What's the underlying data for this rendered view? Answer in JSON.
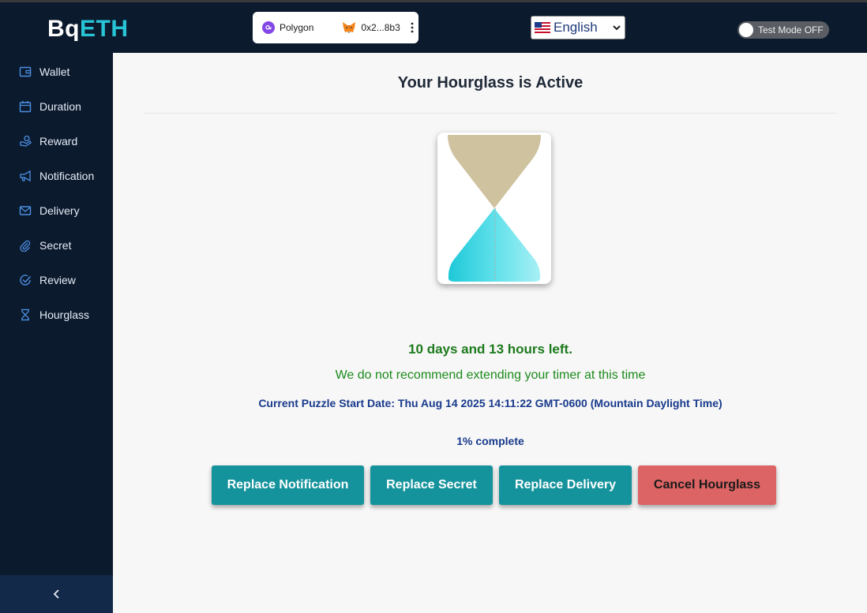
{
  "header": {
    "logo_main": "Bq",
    "logo_accent": "ETH",
    "network": "Polygon",
    "wallet_address": "0x2...8b3",
    "language": "English",
    "test_mode_label": "Test Mode OFF",
    "test_mode_on": false
  },
  "sidebar": {
    "items": [
      {
        "label": "Wallet",
        "icon": "wallet-icon"
      },
      {
        "label": "Duration",
        "icon": "calendar-icon"
      },
      {
        "label": "Reward",
        "icon": "reward-icon"
      },
      {
        "label": "Notification",
        "icon": "megaphone-icon"
      },
      {
        "label": "Delivery",
        "icon": "envelope-icon"
      },
      {
        "label": "Secret",
        "icon": "paperclip-icon"
      },
      {
        "label": "Review",
        "icon": "check-circle-icon"
      },
      {
        "label": "Hourglass",
        "icon": "hourglass-icon"
      }
    ],
    "collapse_icon": "chevron-left-icon"
  },
  "main": {
    "title": "Your Hourglass is Active",
    "time_left": "10 days and 13 hours left.",
    "recommendation": "We do not recommend extending your timer at this time",
    "start_date": "Current Puzzle Start Date: Thu Aug 14 2025 14:11:22 GMT-0600 (Mountain Daylight Time)",
    "progress_text": "1% complete",
    "progress_fraction": 0.01
  },
  "actions": {
    "replace_notification": "Replace Notification",
    "replace_secret": "Replace Secret",
    "replace_delivery": "Replace Delivery",
    "cancel_hourglass": "Cancel Hourglass"
  },
  "colors": {
    "navy": "#0c1a2e",
    "teal": "#15939c",
    "danger": "#dc6464",
    "sand": "#cfc29e",
    "cyan": "#3fd8e4",
    "success_text": "#1c7a1c",
    "info_text": "#183a8c"
  }
}
